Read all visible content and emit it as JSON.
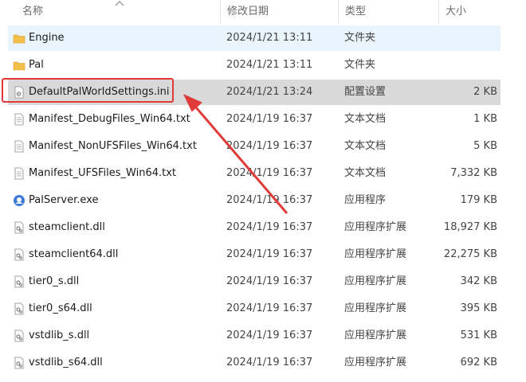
{
  "columns": {
    "name": "名称",
    "date": "修改日期",
    "type": "类型",
    "size": "大小"
  },
  "rows": [
    {
      "name": "Engine",
      "date": "2024/1/21 13:11",
      "type": "文件夹",
      "size": "",
      "icon": "folder-icon"
    },
    {
      "name": "Pal",
      "date": "2024/1/21 13:11",
      "type": "文件夹",
      "size": "",
      "icon": "folder-icon"
    },
    {
      "name": "DefaultPalWorldSettings.ini",
      "date": "2024/1/21 13:24",
      "type": "配置设置",
      "size": "2 KB",
      "icon": "ini-file-icon"
    },
    {
      "name": "Manifest_DebugFiles_Win64.txt",
      "date": "2024/1/19 16:37",
      "type": "文本文档",
      "size": "1 KB",
      "icon": "text-file-icon"
    },
    {
      "name": "Manifest_NonUFSFiles_Win64.txt",
      "date": "2024/1/19 16:37",
      "type": "文本文档",
      "size": "5 KB",
      "icon": "text-file-icon"
    },
    {
      "name": "Manifest_UFSFiles_Win64.txt",
      "date": "2024/1/19 16:37",
      "type": "文本文档",
      "size": "7,332 KB",
      "icon": "text-file-icon"
    },
    {
      "name": "PalServer.exe",
      "date": "2024/1/19 16:37",
      "type": "应用程序",
      "size": "179 KB",
      "icon": "exe-icon"
    },
    {
      "name": "steamclient.dll",
      "date": "2024/1/19 16:37",
      "type": "应用程序扩展",
      "size": "18,927 KB",
      "icon": "dll-file-icon"
    },
    {
      "name": "steamclient64.dll",
      "date": "2024/1/19 16:37",
      "type": "应用程序扩展",
      "size": "22,275 KB",
      "icon": "dll-file-icon"
    },
    {
      "name": "tier0_s.dll",
      "date": "2024/1/19 16:37",
      "type": "应用程序扩展",
      "size": "342 KB",
      "icon": "dll-file-icon"
    },
    {
      "name": "tier0_s64.dll",
      "date": "2024/1/19 16:37",
      "type": "应用程序扩展",
      "size": "395 KB",
      "icon": "dll-file-icon"
    },
    {
      "name": "vstdlib_s.dll",
      "date": "2024/1/19 16:37",
      "type": "应用程序扩展",
      "size": "531 KB",
      "icon": "dll-file-icon"
    },
    {
      "name": "vstdlib_s64.dll",
      "date": "2024/1/19 16:37",
      "type": "应用程序扩展",
      "size": "692 KB",
      "icon": "dll-file-icon"
    }
  ],
  "colors": {
    "annotation": "#e03a3a",
    "hover": "#eaf4fd",
    "selected": "#d9d9d9",
    "folder": "#f4c04a"
  }
}
